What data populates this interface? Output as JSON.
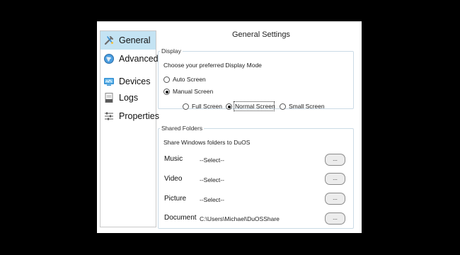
{
  "sidebar": {
    "items": [
      {
        "label": "General",
        "icon": "wrench-wand-icon",
        "active": true
      },
      {
        "label": "Advanced",
        "icon": "globe-icon",
        "active": false
      },
      {
        "label": "Devices",
        "icon": "devices-icon",
        "active": false
      },
      {
        "label": "Logs",
        "icon": "log-file-icon",
        "active": false
      },
      {
        "label": "Properties",
        "icon": "sliders-icon",
        "active": false
      }
    ]
  },
  "main": {
    "title": "General Settings",
    "display": {
      "legend": "Display",
      "prompt": "Choose your preferred Display Mode",
      "modes": [
        {
          "label": "Auto Screen",
          "checked": false
        },
        {
          "label": "Manual Screen",
          "checked": true
        }
      ],
      "sizes": [
        {
          "label": "Full Screen",
          "checked": false
        },
        {
          "label": "Normal Screen",
          "checked": true
        },
        {
          "label": "Small Screen",
          "checked": false
        }
      ]
    },
    "shared": {
      "legend": "Shared Folders",
      "prompt": "Share Windows folders to DuOS",
      "folders": [
        {
          "label": "Music",
          "value": "--Select--",
          "button": "..."
        },
        {
          "label": "Video",
          "value": "--Select--",
          "button": "..."
        },
        {
          "label": "Picture",
          "value": "--Select--",
          "button": "..."
        },
        {
          "label": "Document",
          "value": "C:\\Users\\Michael\\DuOSShare",
          "button": "..."
        }
      ]
    }
  },
  "colors": {
    "active_nav": "#c4e3f3",
    "group_border": "#cbdbe6",
    "background": "#000000"
  }
}
